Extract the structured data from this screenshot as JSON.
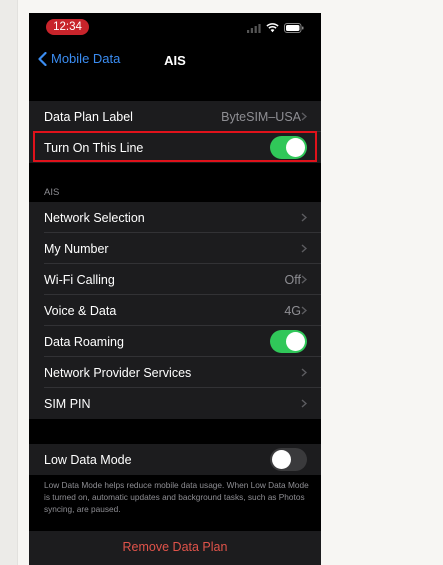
{
  "status_bar": {
    "time": "12:34"
  },
  "nav": {
    "back_label": "Mobile Data",
    "title": "AIS"
  },
  "plan_group": [
    {
      "label": "Data Plan Label",
      "value": "ByteSIM–USA",
      "control": "chevron"
    },
    {
      "label": "Turn On This Line",
      "control": "toggle",
      "toggle_on": true
    }
  ],
  "section_header": "AIS",
  "ais_group": [
    {
      "label": "Network Selection",
      "value": "",
      "control": "chevron"
    },
    {
      "label": "My Number",
      "value": "",
      "control": "chevron"
    },
    {
      "label": "Wi-Fi Calling",
      "value": "Off",
      "control": "chevron"
    },
    {
      "label": "Voice & Data",
      "value": "4G",
      "control": "chevron"
    },
    {
      "label": "Data Roaming",
      "control": "toggle",
      "toggle_on": true
    },
    {
      "label": "Network Provider Services",
      "value": "",
      "control": "chevron"
    },
    {
      "label": "SIM PIN",
      "value": "",
      "control": "chevron"
    }
  ],
  "low_data": {
    "label": "Low Data Mode",
    "toggle_on": false,
    "note": "Low Data Mode helps reduce mobile data usage. When Low Data Mode is turned on, automatic updates and background tasks, such as Photos syncing, are paused."
  },
  "remove_label": "Remove Data Plan",
  "colors": {
    "accent": "#3b8df2",
    "toggle_on": "#30c759",
    "destructive": "#e0534a",
    "highlight": "#e0121b"
  }
}
